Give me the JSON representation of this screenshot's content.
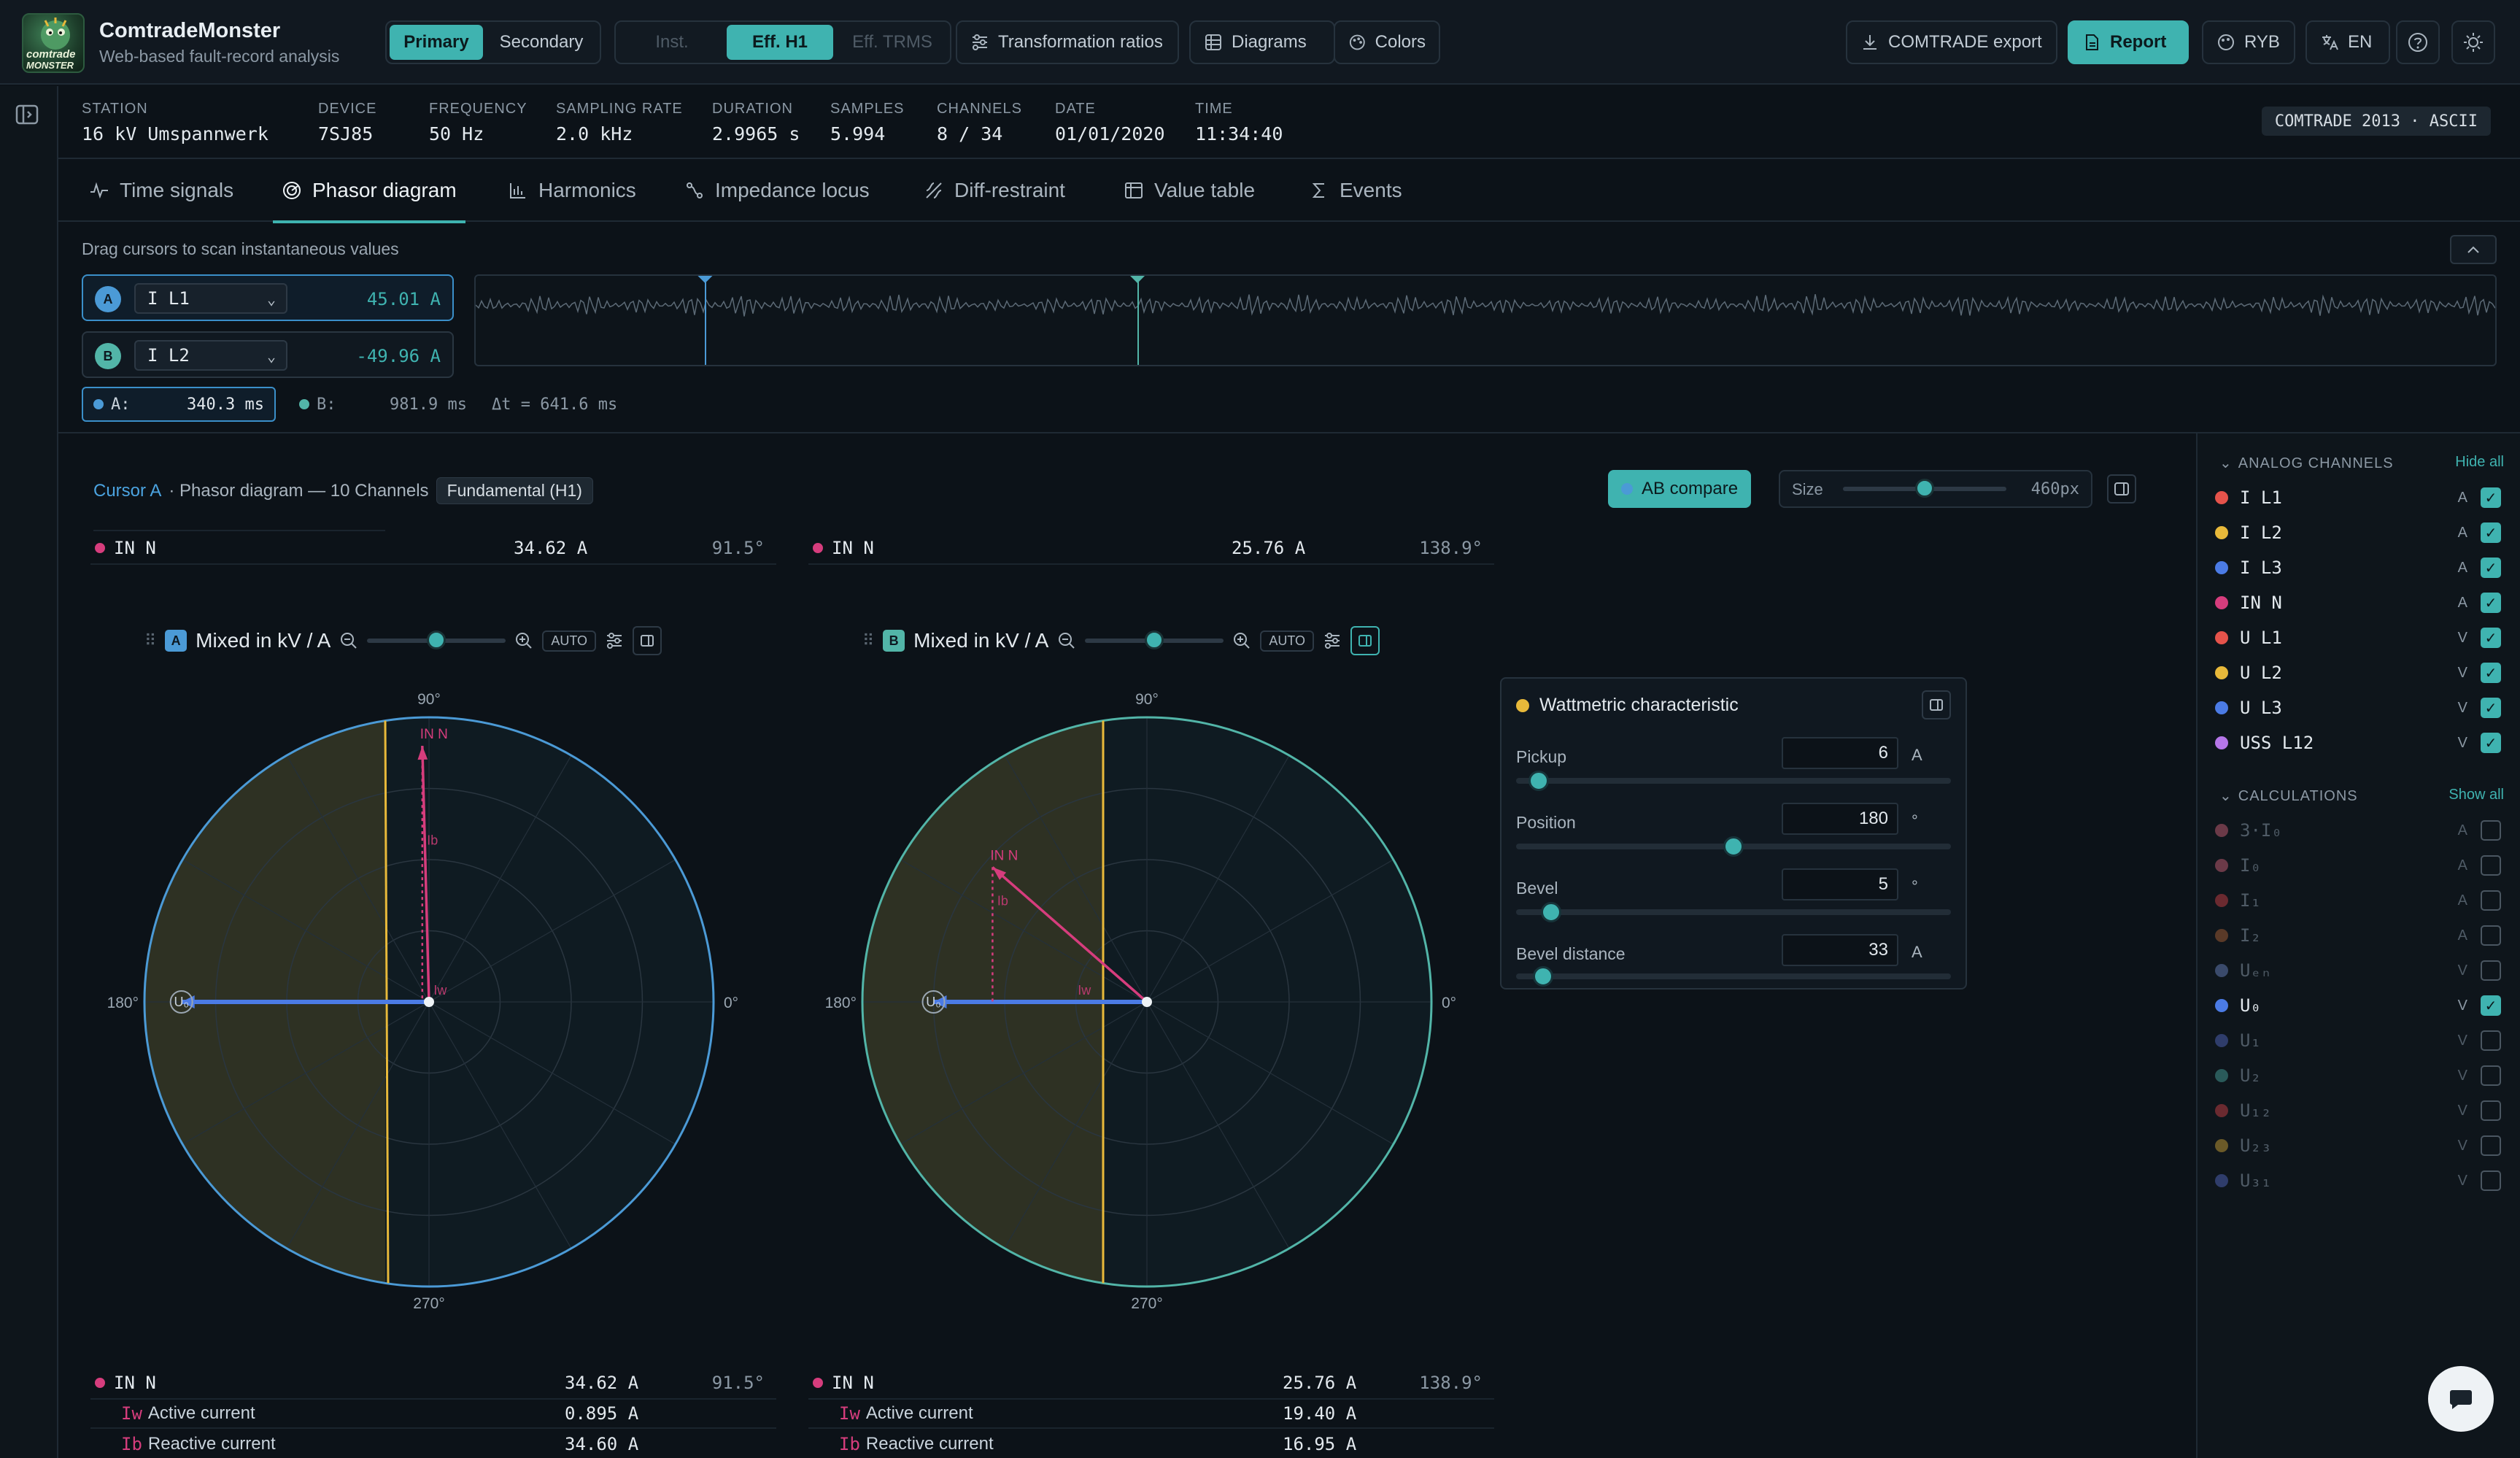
{
  "app": {
    "title": "ComtradeMonster",
    "subtitle": "Web-based fault-record analysis",
    "logo_line1": "comtrade",
    "logo_line2": "MONSTER"
  },
  "toolbar": {
    "side_toggle": [
      "Primary",
      "Secondary"
    ],
    "side_active": 0,
    "mode_toggle": [
      "Inst.",
      "Eff. H1",
      "Eff. TRMS"
    ],
    "mode_active": 1,
    "transformation": "Transformation ratios",
    "diagrams": "Diagrams",
    "colors": "Colors",
    "export": "COMTRADE export",
    "report": "Report",
    "ryb": "RYB",
    "lang": "EN"
  },
  "info": [
    {
      "label": "STATION",
      "value": "16 kV Umspannwerk"
    },
    {
      "label": "DEVICE",
      "value": "7SJ85"
    },
    {
      "label": "FREQUENCY",
      "value": "50 Hz"
    },
    {
      "label": "SAMPLING RATE",
      "value": "2.0 kHz"
    },
    {
      "label": "DURATION",
      "value": "2.9965 s"
    },
    {
      "label": "SAMPLES",
      "value": "5.994"
    },
    {
      "label": "CHANNELS",
      "value": "8 / 34"
    },
    {
      "label": "DATE",
      "value": "01/01/2020"
    },
    {
      "label": "TIME",
      "value": "11:34:40"
    }
  ],
  "format_badge": "COMTRADE 2013 · ASCII",
  "tabs": [
    "Time signals",
    "Phasor diagram",
    "Harmonics",
    "Impedance locus",
    "Diff-restraint",
    "Value table",
    "Events"
  ],
  "tab_active": 1,
  "cursor": {
    "hint": "Drag cursors to scan instantaneous values",
    "a": {
      "badge": "A",
      "channel": "I L1",
      "value": "45.01 A"
    },
    "b": {
      "badge": "B",
      "channel": "I L2",
      "value": "-49.96 A"
    },
    "a_time_label": "A:",
    "a_time": "340.3 ms",
    "b_time_label": "B:",
    "b_time": "981.9 ms",
    "delta": "Δt = 641.6 ms",
    "a_position": 0.3404,
    "b_position": 0.9819,
    "duration_s": 2.9965
  },
  "plot": {
    "cursor_link": "Cursor A",
    "header_rest": "· Phasor diagram — 10 Channels",
    "pill": "Fundamental (H1)",
    "ab_compare": "AB compare",
    "size_label": "Size",
    "size_value": "460px",
    "size_fraction": 0.5
  },
  "panel_a": {
    "badge": "A",
    "title": "Mixed in kV / A",
    "auto": "AUTO",
    "top_row": {
      "name": "IN N",
      "value": "34.62 A",
      "angle": "91.5°"
    },
    "bottom_rows": [
      {
        "name": "IN N",
        "value": "34.62 A",
        "angle": "91.5°",
        "kind": "main"
      },
      {
        "prefix": "Iw",
        "name": "Active current",
        "value": "0.895 A",
        "kind": "sub"
      },
      {
        "prefix": "Ib",
        "name": "Reactive current",
        "value": "34.60 A",
        "kind": "sub"
      }
    ],
    "phasor_label": "IN N",
    "ib_label": "Ib",
    "iw_label": "Iw",
    "u_label": "U₀",
    "in_angle_deg": 91.5,
    "in_mag": 0.9,
    "u_angle_deg": 180,
    "u_mag": 0.87,
    "zoom": 0.5
  },
  "panel_b": {
    "badge": "B",
    "title": "Mixed in kV / A",
    "auto": "AUTO",
    "top_row": {
      "name": "IN N",
      "value": "25.76 A",
      "angle": "138.9°"
    },
    "bottom_rows": [
      {
        "name": "IN N",
        "value": "25.76 A",
        "angle": "138.9°",
        "kind": "main"
      },
      {
        "prefix": "Iw",
        "name": "Active current",
        "value": "19.40 A",
        "kind": "sub"
      },
      {
        "prefix": "Ib",
        "name": "Reactive current",
        "value": "16.95 A",
        "kind": "sub"
      }
    ],
    "phasor_label": "IN N",
    "ib_label": "Ib",
    "iw_label": "Iw",
    "u_label": "U₀",
    "in_angle_deg": 138.9,
    "in_mag": 0.72,
    "u_angle_deg": 180,
    "u_mag": 0.75,
    "zoom": 0.5
  },
  "axis_labels": {
    "deg90": "90°",
    "deg180": "180°",
    "deg0": "0°",
    "deg270": "270°"
  },
  "wattmetric": {
    "title": "Wattmetric characteristic",
    "params": [
      {
        "label": "Pickup",
        "value": "6",
        "unit": "A",
        "fraction": 0.03
      },
      {
        "label": "Position",
        "value": "180",
        "unit": "°",
        "fraction": 0.5
      },
      {
        "label": "Bevel",
        "value": "5",
        "unit": "°",
        "fraction": 0.06
      },
      {
        "label": "Bevel distance",
        "value": "33",
        "unit": "A",
        "fraction": 0.04
      }
    ]
  },
  "analog": {
    "header": "ANALOG CHANNELS",
    "action": "Hide all",
    "channels": [
      {
        "name": "I L1",
        "unit": "A",
        "color": "#e5534b",
        "checked": true
      },
      {
        "name": "I L2",
        "unit": "A",
        "color": "#e8b93a",
        "checked": true
      },
      {
        "name": "I L3",
        "unit": "A",
        "color": "#4b7be5",
        "checked": true
      },
      {
        "name": "IN N",
        "unit": "A",
        "color": "#d63d7d",
        "checked": true
      },
      {
        "name": "U L1",
        "unit": "V",
        "color": "#e5534b",
        "checked": true
      },
      {
        "name": "U L2",
        "unit": "V",
        "color": "#e8b93a",
        "checked": true
      },
      {
        "name": "U L3",
        "unit": "V",
        "color": "#4b7be5",
        "checked": true
      },
      {
        "name": "USS L12",
        "unit": "V",
        "color": "#b576e8",
        "checked": true
      }
    ]
  },
  "calculations": {
    "header": "CALCULATIONS",
    "action": "Show all",
    "channels": [
      {
        "name": "3·I₀",
        "unit": "A",
        "color": "#6b3a48",
        "checked": false
      },
      {
        "name": "I₀",
        "unit": "A",
        "color": "#6b3a48",
        "checked": false
      },
      {
        "name": "I₁",
        "unit": "A",
        "color": "#6b2a30",
        "checked": false
      },
      {
        "name": "I₂",
        "unit": "A",
        "color": "#5a3a28",
        "checked": false
      },
      {
        "name": "Uₑₙ",
        "unit": "V",
        "color": "#3a4a6b",
        "checked": false
      },
      {
        "name": "U₀",
        "unit": "V",
        "color": "#4b7be5",
        "checked": true
      },
      {
        "name": "U₁",
        "unit": "V",
        "color": "#2f3d6b",
        "checked": false
      },
      {
        "name": "U₂",
        "unit": "V",
        "color": "#2a5a5a",
        "checked": false
      },
      {
        "name": "U₁₂",
        "unit": "V",
        "color": "#6b2a30",
        "checked": false
      },
      {
        "name": "U₂₃",
        "unit": "V",
        "color": "#6b5a28",
        "checked": false
      },
      {
        "name": "U₃₁",
        "unit": "V",
        "color": "#2f3d6b",
        "checked": false
      }
    ]
  },
  "colors": {
    "accent": "#3fb3b0",
    "in_phasor": "#d63d7d",
    "u_phasor": "#4b7be5",
    "char_line": "#e8b93a",
    "circle_a": "#4b9ad6",
    "circle_b": "#52b5a8"
  }
}
